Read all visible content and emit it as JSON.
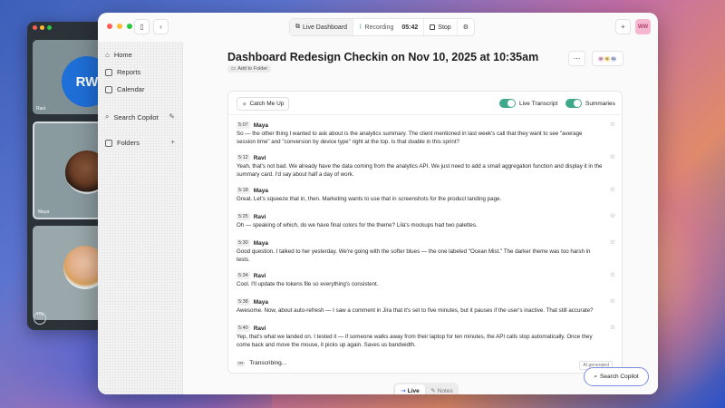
{
  "meeting_window": {
    "tiles": [
      {
        "name": "Ravi",
        "avatar_initials": "RW"
      },
      {
        "name": "Maya"
      },
      {
        "name": "You"
      }
    ],
    "bottom_icon": "more-icon"
  },
  "toolbar": {
    "live_dashboard_label": "Live Dashboard",
    "recording_label": "Recording",
    "recording_time": "05:42",
    "stop_label": "Stop",
    "user_initials": "WW"
  },
  "sidebar": {
    "home": "Home",
    "reports": "Reports",
    "calendar": "Calendar",
    "search_copilot": "Search Copilot",
    "folders": "Folders"
  },
  "document": {
    "title": "Dashboard Redesign Checkin on Nov 10, 2025 at 10:35am",
    "add_to_folder": "Add to Folder",
    "participant_initials": [
      "W",
      "M",
      "RA"
    ]
  },
  "transcript_controls": {
    "catch_me_up": "Catch Me Up",
    "live_transcript": "Live Transcript",
    "summaries": "Summaries"
  },
  "transcript": [
    {
      "time": "5:07",
      "speaker": "Maya",
      "text": "So — the other thing I wanted to ask about is the analytics summary. The client mentioned in last week's call that they want to see \"average session time\" and \"conversion by device type\" right at the top. Is that doable in this sprint?"
    },
    {
      "time": "5:12",
      "speaker": "Ravi",
      "text": "Yeah, that's not bad. We already have the data coming from the analytics API. We just need to add a small aggregation function and display it in the summary card. I'd say about half a day of work."
    },
    {
      "time": "5:18",
      "speaker": "Maya",
      "text": "Great. Let's squeeze that in, then. Marketing wants to use that in screenshots for the product landing page."
    },
    {
      "time": "5:25",
      "speaker": "Ravi",
      "text": "Oh — speaking of which, do we have final colors for the theme? Lila's mockups had two palettes."
    },
    {
      "time": "5:30",
      "speaker": "Maya",
      "text": "Good question. I talked to her yesterday. We're going with the softer blues — the one labeled \"Ocean Mist.\" The darker theme was too harsh in tests."
    },
    {
      "time": "5:34",
      "speaker": "Ravi",
      "text": "Cool. I'll update the tokens file so everything's consistent."
    },
    {
      "time": "5:38",
      "speaker": "Maya",
      "text": "Awesome. Now, about auto-refresh — I saw a comment in Jira that it's set to five minutes, but it pauses if the user's inactive. That still accurate?"
    },
    {
      "time": "5:40",
      "speaker": "Ravi",
      "text": "Yep, that's what we landed on. I tested it — if someone walks away from their laptop for ten minutes, the API calls stop automatically. Once they come back and move the mouse, it picks up again. Saves us bandwidth."
    }
  ],
  "status": {
    "dots": "•••",
    "transcribing": "Transcribing...",
    "ai_generated": "AI generated"
  },
  "view_toggle": {
    "live": "Live",
    "notes": "Notes"
  },
  "search_copilot_button": "Search Copilot",
  "colors": {
    "accent_green": "#3fa88a",
    "copilot_border": "#7a8de0",
    "avatar_blue": "#1e6fd8"
  }
}
